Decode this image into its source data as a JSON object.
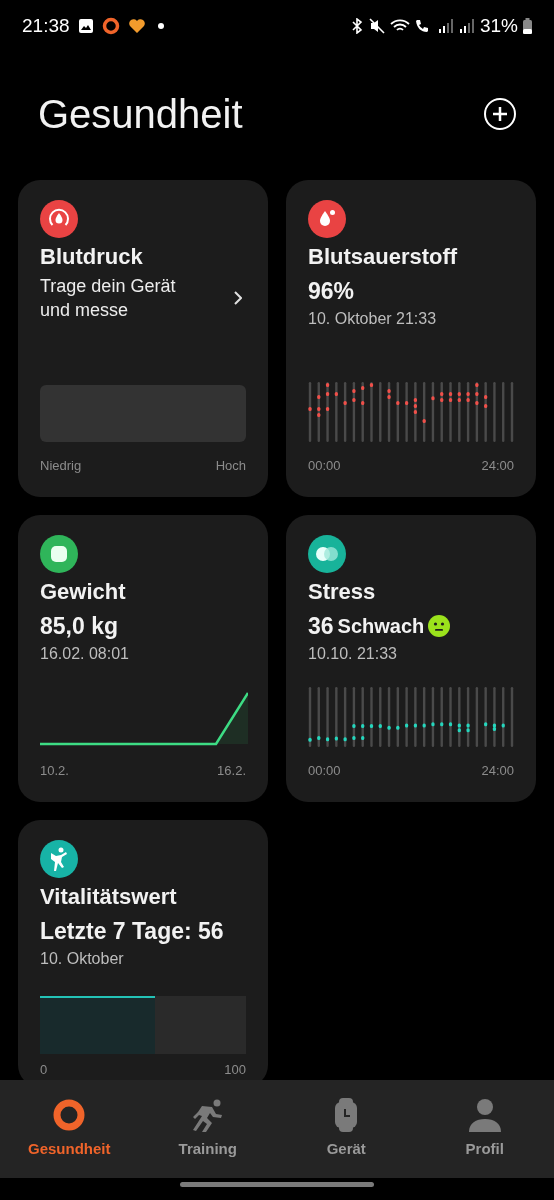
{
  "status_bar": {
    "time": "21:38",
    "battery": "31%"
  },
  "header": {
    "title": "Gesundheit"
  },
  "cards": [
    {
      "kind": "blood_pressure",
      "title": "Blutdruck",
      "message": "Trage dein Gerät und messe",
      "axis": [
        "Niedrig",
        "Hoch"
      ]
    },
    {
      "kind": "blood_oxygen",
      "title": "Blutsauerstoff",
      "value": "96%",
      "timestamp": "10. Oktober 21:33",
      "axis": [
        "00:00",
        "24:00"
      ]
    },
    {
      "kind": "weight",
      "title": "Gewicht",
      "value": "85,0 kg",
      "timestamp": "16.02. 08:01",
      "axis": [
        "10.2.",
        "16.2."
      ]
    },
    {
      "kind": "stress",
      "title": "Stress",
      "value": "36",
      "rating": "Schwach",
      "timestamp": "10.10. 21:33",
      "axis": [
        "00:00",
        "24:00"
      ]
    },
    {
      "kind": "vitality",
      "title": "Vitalitätswert",
      "value": "Letzte 7 Tage: 56",
      "timestamp": "10. Oktober",
      "level": 0.56,
      "axis": [
        "0",
        "100"
      ]
    }
  ],
  "tabs": [
    {
      "label": "Gesundheit",
      "selected": true
    },
    {
      "label": "Training",
      "selected": false
    },
    {
      "label": "Gerät",
      "selected": false
    },
    {
      "label": "Profil",
      "selected": false
    }
  ]
}
